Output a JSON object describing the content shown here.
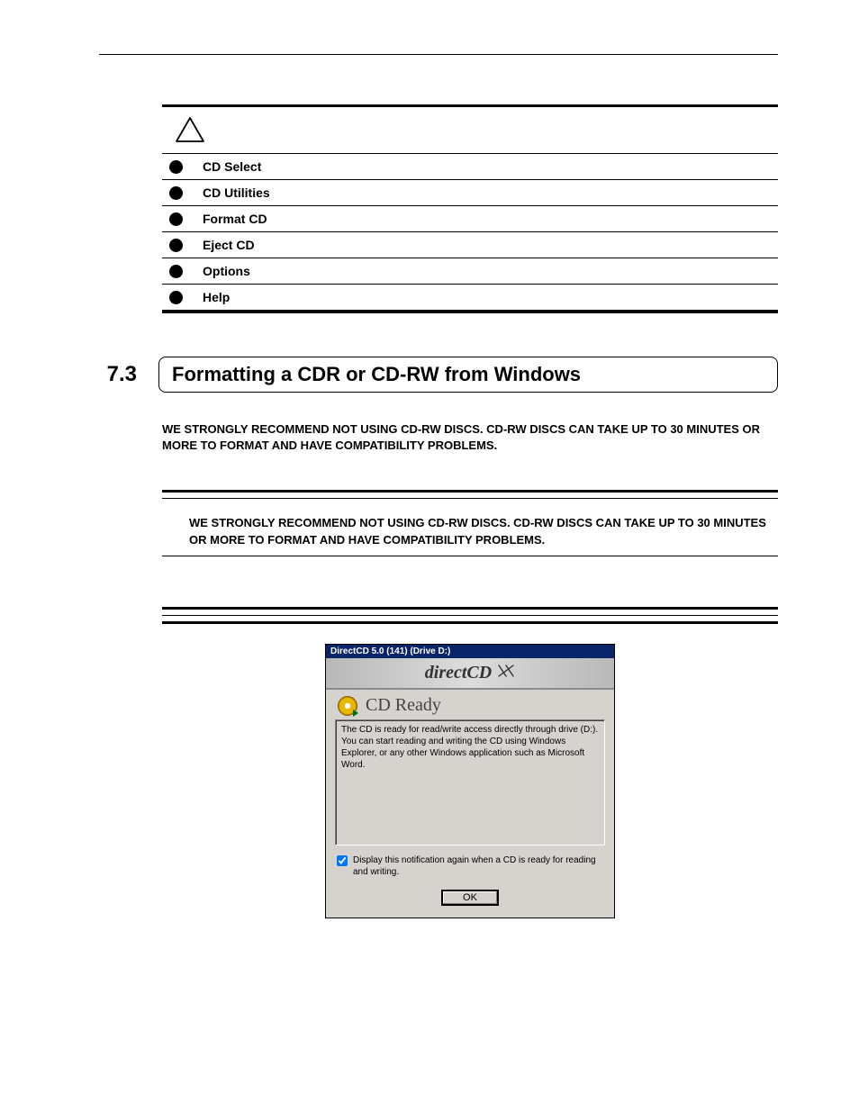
{
  "menu": {
    "items": [
      {
        "label": "CD Select"
      },
      {
        "label": "CD Utilities"
      },
      {
        "label": "Format CD"
      },
      {
        "label": "Eject CD"
      },
      {
        "label": "Options"
      },
      {
        "label": "Help"
      }
    ]
  },
  "section": {
    "number": "7.3",
    "title": "Formatting a CDR or CD-RW from Windows"
  },
  "warnings": {
    "w1": "WE STRONGLY RECOMMEND NOT USING CD-RW DISCS. CD-RW DISCS CAN TAKE UP TO 30 MINUTES OR MORE TO FORMAT AND HAVE COMPATIBILITY PROBLEMS.",
    "w2": "WE STRONGLY RECOMMEND NOT USING CD-RW DISCS. CD-RW DISCS CAN TAKE UP TO 30 MINUTES OR MORE TO FORMAT AND HAVE COMPATIBILITY PROBLEMS."
  },
  "dialog": {
    "title": "DirectCD 5.0 (141) (Drive D:)",
    "logo": "directCD",
    "status": "CD Ready",
    "info": "The CD is ready for read/write access directly through drive (D:). You can start reading and writing the CD using Windows Explorer, or any other Windows application such as Microsoft Word.",
    "checkbox_label": "Display this notification again when a CD is ready for reading and writing.",
    "ok": "OK"
  }
}
